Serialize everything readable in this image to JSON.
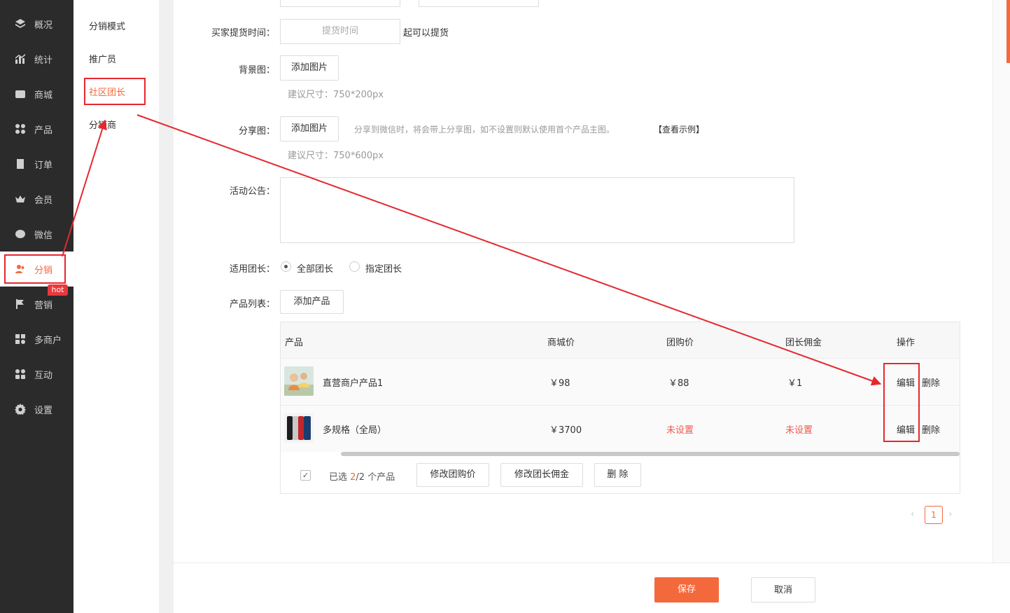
{
  "sidebar": {
    "items": [
      {
        "label": "概况",
        "icon": "layers-icon"
      },
      {
        "label": "统计",
        "icon": "chart-icon"
      },
      {
        "label": "商城",
        "icon": "mall-icon"
      },
      {
        "label": "产品",
        "icon": "grid-icon"
      },
      {
        "label": "订单",
        "icon": "order-icon"
      },
      {
        "label": "会员",
        "icon": "crown-icon"
      },
      {
        "label": "微信",
        "icon": "wechat-icon"
      },
      {
        "label": "分销",
        "icon": "users-icon"
      },
      {
        "label": "营销",
        "icon": "flag-icon"
      },
      {
        "label": "多商户",
        "icon": "store-icon"
      },
      {
        "label": "互动",
        "icon": "interact-icon"
      },
      {
        "label": "设置",
        "icon": "gear-icon"
      }
    ],
    "hot_badge": "hot"
  },
  "submenu": {
    "items": [
      "分销模式",
      "推广员",
      "社区团长",
      "分销商"
    ]
  },
  "form": {
    "pickup_label": "买家提货时间：",
    "pickup_placeholder": "提货时间",
    "pickup_suffix": "起可以提货",
    "bg_label": "背景图：",
    "add_image": "添加图片",
    "bg_hint": "建议尺寸：750*200px",
    "share_label": "分享图：",
    "share_tip": "分享到微信时，将会带上分享图，如不设置则默认使用首个产品主图。",
    "share_example": "【查看示例】",
    "share_hint": "建议尺寸：750*600px",
    "notice_label": "活动公告：",
    "leader_label": "适用团长：",
    "leader_all": "全部团长",
    "leader_specific": "指定团长",
    "product_label": "产品列表：",
    "add_product": "添加产品"
  },
  "table": {
    "headers": [
      "产品",
      "商城价",
      "团购价",
      "团长佣金",
      "操作"
    ],
    "rows": [
      {
        "name": "直营商户产品1",
        "mall_price": "￥98",
        "group_price": "￥88",
        "commission": "￥1",
        "group_unset": false,
        "commission_unset": false
      },
      {
        "name": "多规格（全局）",
        "mall_price": "￥3700",
        "group_price": "未设置",
        "commission": "未设置",
        "group_unset": true,
        "commission_unset": true
      }
    ],
    "edit": "编辑",
    "delete": "删除",
    "selected_prefix": "已选 ",
    "selected_count": "2",
    "selected_suffix": "/2 个产品",
    "bulk_group_price": "修改团购价",
    "bulk_commission": "修改团长佣金",
    "bulk_delete": "删 除"
  },
  "pagination": {
    "current": "1"
  },
  "footer": {
    "save": "保存",
    "cancel": "取消"
  },
  "colors": {
    "accent": "#f4693c",
    "sidebar_bg": "#2b2b2b",
    "annotation": "#e5282c",
    "unset": "#ee5a50"
  }
}
